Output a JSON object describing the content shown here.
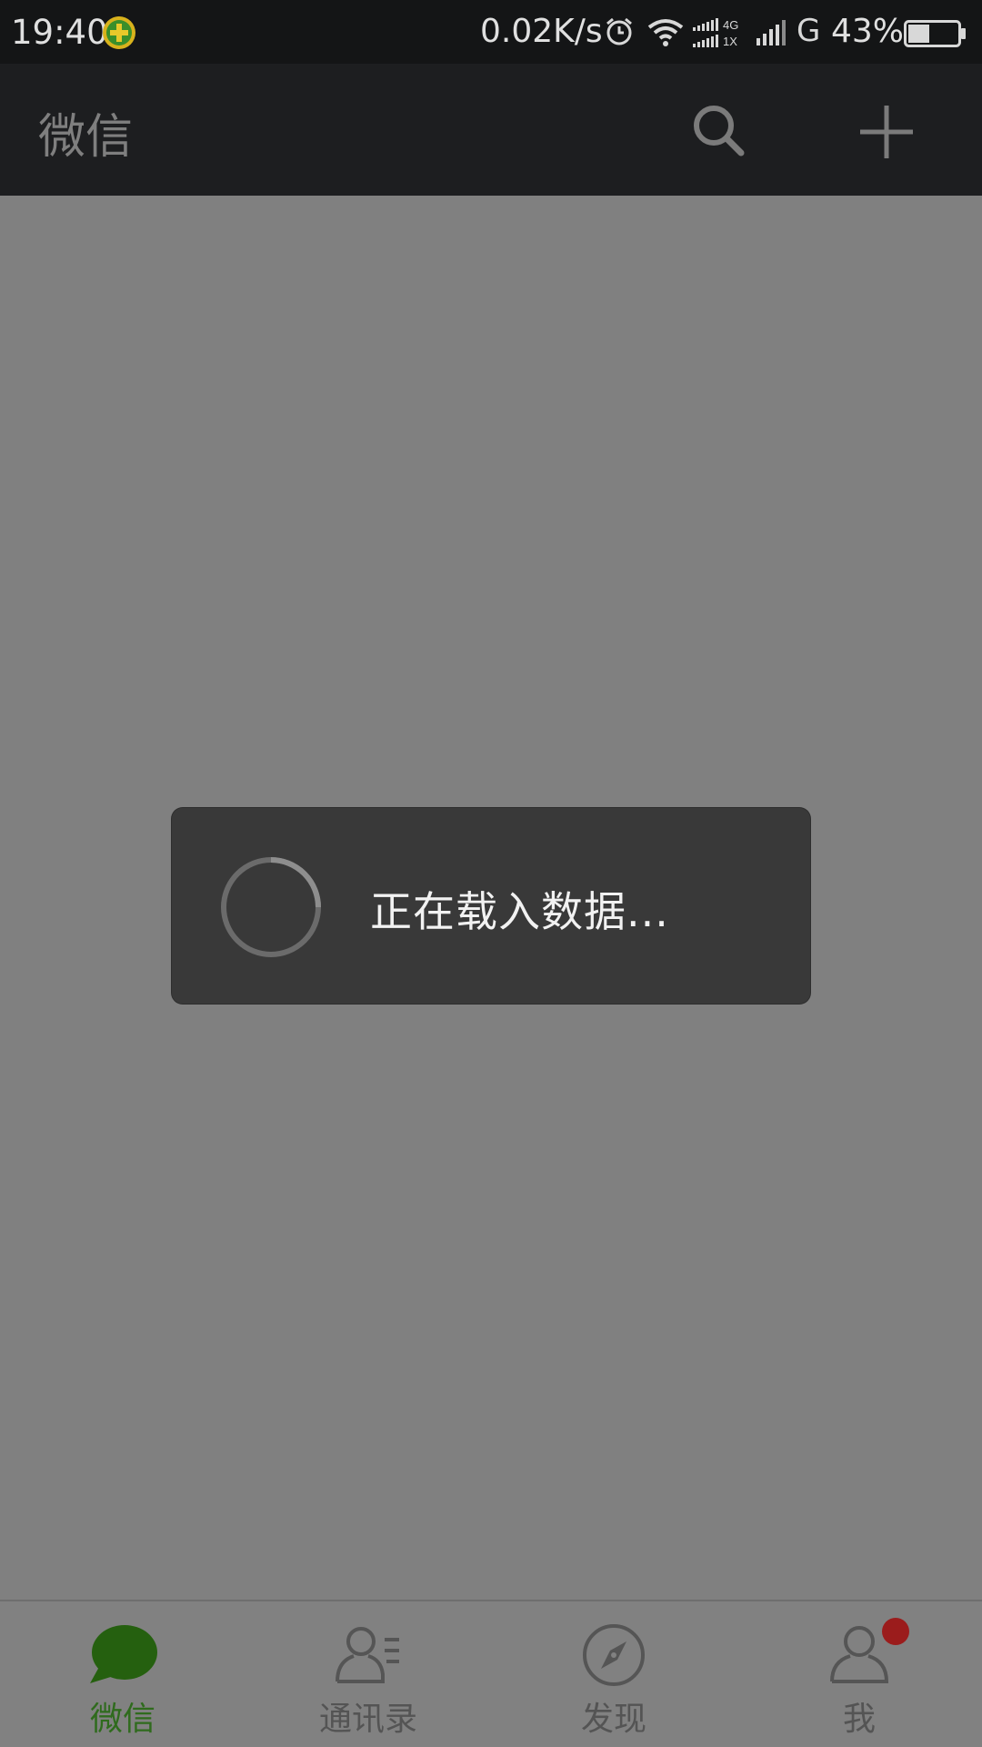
{
  "status_bar": {
    "time": "19:40",
    "speed": "0.02K/s",
    "network_type": "G",
    "battery_pct": "43%",
    "battery_level": 0.43,
    "signal_small_top": "4G",
    "signal_small_bottom": "1X",
    "icons": [
      "shield-icon",
      "alarm-icon",
      "wifi-icon",
      "signal-4g-1x-icon",
      "signal-icon",
      "battery-icon"
    ]
  },
  "app_bar": {
    "title": "微信",
    "icons": [
      "search-icon",
      "add-icon"
    ]
  },
  "loading_dialog": {
    "message": "正在载入数据..."
  },
  "bottom_nav": {
    "items": [
      {
        "label": "微信",
        "icon": "chat-bubble-icon",
        "active": true
      },
      {
        "label": "通讯录",
        "icon": "contacts-icon",
        "active": false
      },
      {
        "label": "发现",
        "icon": "compass-icon",
        "active": false
      },
      {
        "label": "我",
        "icon": "profile-icon",
        "active": false,
        "badge": true
      }
    ]
  },
  "colors": {
    "status_bar_bg": "#141516",
    "app_bar_bg": "#1d1e20",
    "overlay_bg": "#808080",
    "dialog_bg": "#393939",
    "active_green": "#2f6b1d",
    "badge_red": "#9b1c1c"
  }
}
